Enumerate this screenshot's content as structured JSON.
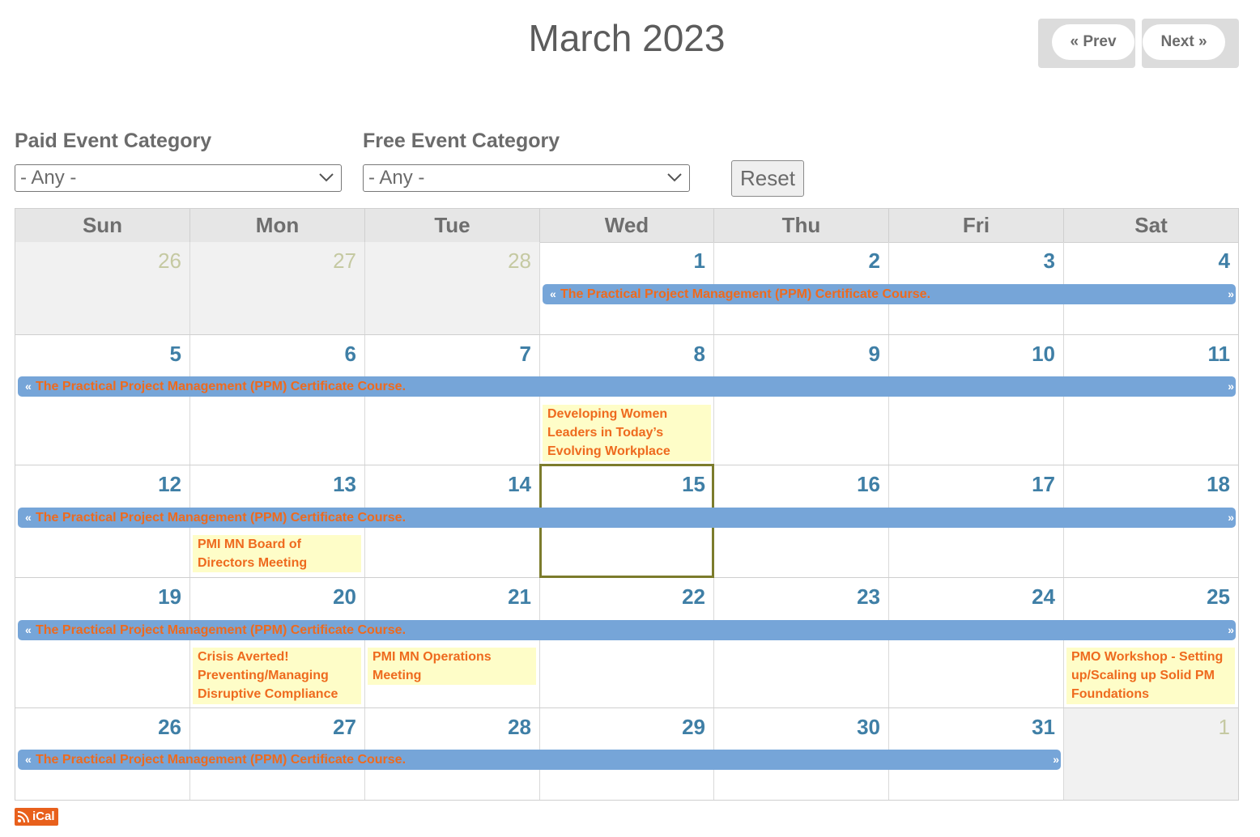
{
  "header": {
    "title": "March 2023",
    "prev_label": "« Prev",
    "next_label": "Next »"
  },
  "filters": {
    "paid_label": "Paid Event Category",
    "paid_value": "- Any -",
    "free_label": "Free Event Category",
    "free_value": "- Any -",
    "reset_label": "Reset"
  },
  "calendar": {
    "days_of_week": [
      "Sun",
      "Mon",
      "Tue",
      "Wed",
      "Thu",
      "Fri",
      "Sat"
    ],
    "weeks": [
      [
        "26",
        "27",
        "28",
        "1",
        "2",
        "3",
        "4"
      ],
      [
        "5",
        "6",
        "7",
        "8",
        "9",
        "10",
        "11"
      ],
      [
        "12",
        "13",
        "14",
        "15",
        "16",
        "17",
        "18"
      ],
      [
        "19",
        "20",
        "21",
        "22",
        "23",
        "24",
        "25"
      ],
      [
        "26",
        "27",
        "28",
        "29",
        "30",
        "31",
        "1"
      ]
    ],
    "today": "15",
    "multi_day_event": {
      "title": "The Practical Project Management (PPM) Certificate Course.",
      "left_arrow": "«",
      "right_arrow": "»"
    },
    "events": {
      "developing_women": "Developing Women Leaders in Today’s Evolving Workplace",
      "board_meeting": "PMI MN Board of Directors Meeting",
      "crisis_averted": "Crisis Averted! Preventing/Managing Disruptive Compliance",
      "operations_meeting": "PMI MN Operations Meeting",
      "pmo_workshop": "PMO Workshop - Setting up/Scaling up Solid PM Foundations"
    }
  },
  "footer": {
    "ical_label": "iCal"
  },
  "colors": {
    "day_number": "#3f7fa6",
    "event_bar": "#76a5d8",
    "event_text": "#ee6a1e",
    "event_bg": "#fefdc8",
    "today_border": "#7c7c2c"
  }
}
